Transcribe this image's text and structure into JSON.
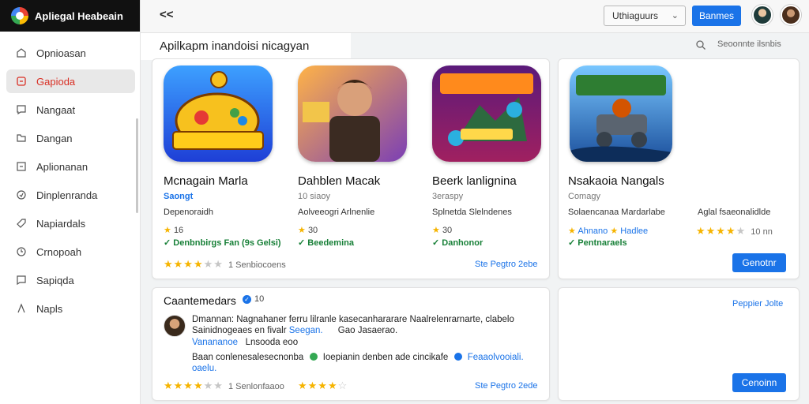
{
  "app": {
    "title": "Apliegal Heabeain"
  },
  "sidebar": {
    "items": [
      {
        "label": "Opnioasan",
        "icon": "home-icon",
        "active": false
      },
      {
        "label": "Gapioda",
        "icon": "apps-icon",
        "active": true
      },
      {
        "label": "Nangaat",
        "icon": "chat-icon",
        "active": false
      },
      {
        "label": "Dangan",
        "icon": "folder-icon",
        "active": false
      },
      {
        "label": "Aplionanan",
        "icon": "minus-box-icon",
        "active": false
      },
      {
        "label": "Dinplenranda",
        "icon": "shield-icon",
        "active": false
      },
      {
        "label": "Napiardals",
        "icon": "tag-icon",
        "active": false
      },
      {
        "label": "Crnopoah",
        "icon": "bell-icon",
        "active": false
      },
      {
        "label": "Sapiqda",
        "icon": "message-icon",
        "active": false
      },
      {
        "label": "Napls",
        "icon": "settings-icon",
        "active": false
      }
    ]
  },
  "topbar": {
    "back_label": "<<",
    "dropdown_value": "Uthiaguurs",
    "primary_button": "Banmes"
  },
  "page": {
    "heading": "Apilkapm inandoisi nicagyan",
    "search_label": "Seoonnte ilsnbis"
  },
  "apps": [
    {
      "name": "Mcnagain Marla",
      "developer": "Saongt",
      "category": "Depenoraidh",
      "rating": "16",
      "badge": "Denbnbirgs Fan (9s Gelsi)",
      "stars_count": "1 Senbiocoens"
    },
    {
      "name": "Dahblen Macak",
      "developer": "10 siaoy",
      "category": "Aolveeogri Arlnenlie",
      "rating": "30",
      "badge": "Beedemina",
      "stars_count": ""
    },
    {
      "name": "Beerk lanlignina",
      "developer": "3eraspy",
      "category": "Splnetda Slelndenes",
      "rating": "30",
      "badge": "Danhonor",
      "stars_count": ""
    },
    {
      "name": "Nsakaoia Nangals",
      "developer": "Comagy",
      "category": "Solaencanaa Mardarlabe",
      "extra": "Aglal fsaeonalidlde",
      "badge_1": "Ahnano",
      "badge_2": "Hadlee",
      "badge_3": "Pentnaraels",
      "stars_count": "10 nn"
    }
  ],
  "links": {
    "see_more_1": "Ste Pegtro 2ebe",
    "see_more_2": "Ste Pegtro 2ede",
    "popular": "Peppier Jolte"
  },
  "buttons": {
    "right_top": "Genotnr",
    "right_bottom": "Cenoinn"
  },
  "reviews": {
    "title": "Caantemedars",
    "badge_count": "10",
    "line1": "Dmannan: Nagnahaner ferru lilranle kasecanhararare Naalrelenrarnarte, clabelo",
    "line2_a": "Sainidnogeaes en fivalr",
    "line2_b": "Seegan.",
    "line2_c": "Gao Jasaerao.",
    "line3_a": "Vanananoe",
    "line3_b": "Lnsooda eoo",
    "line4_a": "Baan conlenesalesecnonba",
    "line4_b": "Ioepianin denben ade cincikafe",
    "line4_c": "Feaaolvooiali.",
    "line5": "oaelu.",
    "stars_count": "1 Senlonfaaoo"
  },
  "colors": {
    "accent": "#1a73e8",
    "active_nav": "#d93025",
    "star": "#f6b400",
    "success": "#188038"
  }
}
